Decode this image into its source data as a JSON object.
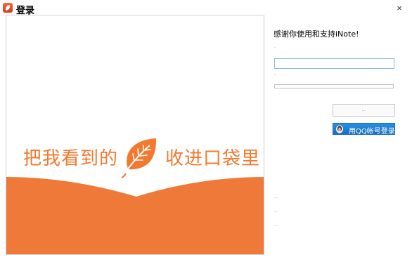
{
  "window": {
    "title": "登录",
    "close_glyph": "×",
    "icon": "app-leaf-icon"
  },
  "banner": {
    "slogan_left": "把我看到的",
    "slogan_right": "收进口袋里",
    "accent_color": "#f27a30",
    "leaf_icon": "leaf-logo-icon"
  },
  "login": {
    "welcome": "感谢你使用和支持iNote!",
    "account_label": "..",
    "password_label": "...",
    "account_value": "",
    "password_value": "",
    "login_button": "...",
    "qq_button": "用QQ帐号登录",
    "qq_icon": "qq-penguin-icon"
  },
  "links": {
    "link1": ".....",
    "link2": "....",
    "link3": "....."
  }
}
